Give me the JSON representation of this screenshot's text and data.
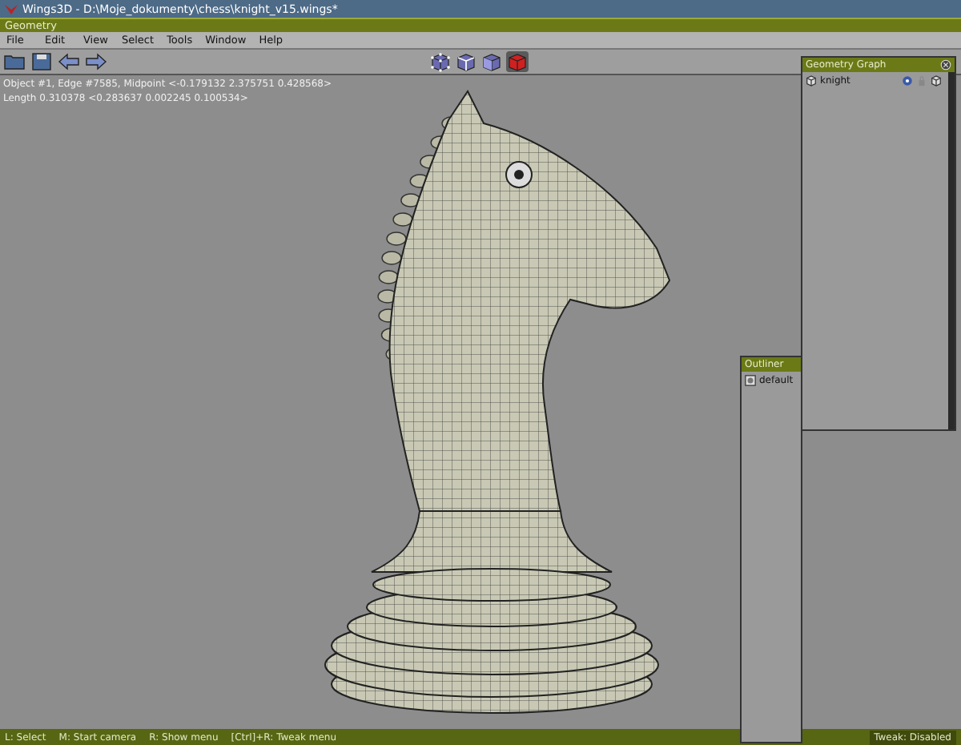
{
  "window": {
    "title": "Wings3D - D:\\Moje_dokumenty\\chess\\knight_v15.wings*"
  },
  "geometry_window": {
    "title": "Geometry"
  },
  "menu": [
    "File",
    "Edit",
    "View",
    "Select",
    "Tools",
    "Window",
    "Help"
  ],
  "selection_modes": [
    {
      "kind": "vertex",
      "selected": false
    },
    {
      "kind": "edge",
      "selected": false
    },
    {
      "kind": "face",
      "selected": false
    },
    {
      "kind": "body",
      "selected": true
    }
  ],
  "info": [
    "Object #1, Edge #7585, Midpoint <-0.179132  2.375751  0.428568>",
    "Length 0.310378  <0.283637  0.002245  0.100534>"
  ],
  "geometry_graph": {
    "title": "Geometry Graph",
    "items": [
      {
        "name": "knight"
      }
    ]
  },
  "outliner": {
    "title": "Outliner",
    "items": [
      {
        "name": "default"
      }
    ]
  },
  "status_bar": {
    "hints": [
      "L: Select",
      "M: Start camera",
      "R: Show menu",
      "[Ctrl]+R: Tweak menu"
    ],
    "tweak": "Tweak: Disabled"
  }
}
